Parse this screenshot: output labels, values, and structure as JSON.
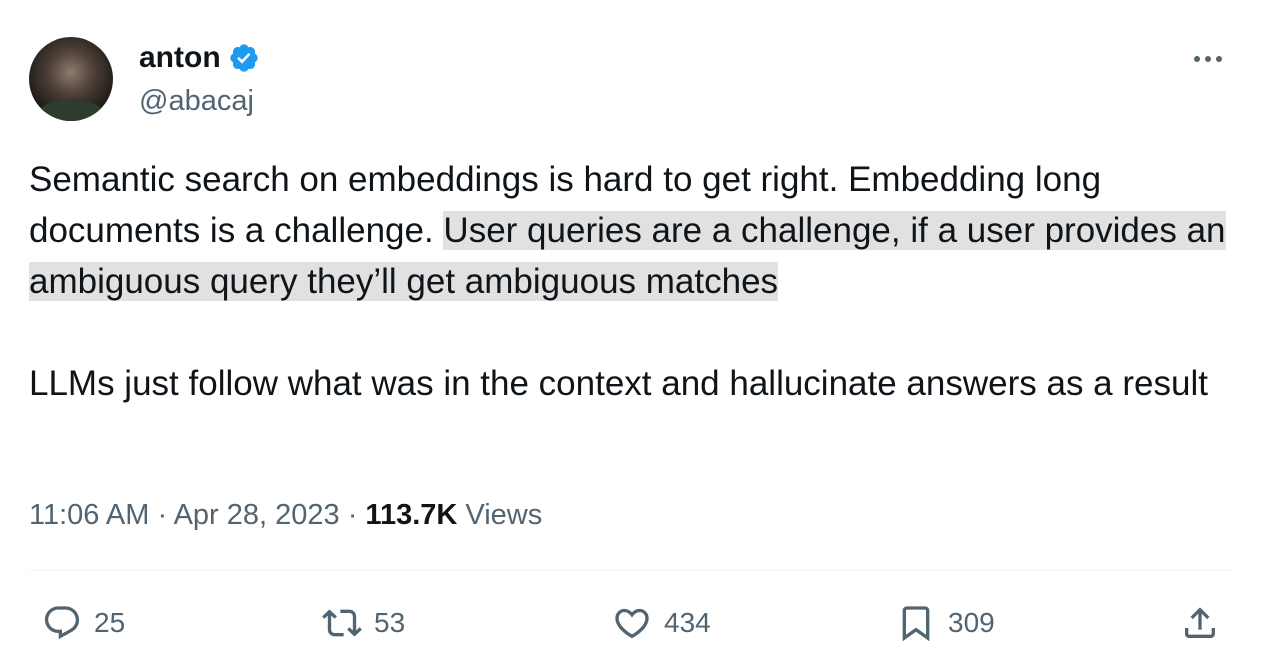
{
  "author": {
    "display_name": "anton",
    "handle": "@abacaj",
    "verified": true,
    "verified_color": "#1d9bf0"
  },
  "tweet": {
    "paragraph1_plain": "Semantic search on embeddings is hard to get right. Embedding long documents is a challenge. ",
    "paragraph1_highlighted": "User queries are a challenge, if a user provides an ambiguous query they’ll get ambiguous matches",
    "paragraph2": "LLMs just follow what was in the context and hallucinate answers as a result"
  },
  "meta": {
    "time": "11:06 AM",
    "separator": " · ",
    "date": "Apr 28, 2023",
    "views_count": "113.7K",
    "views_label": " Views"
  },
  "actions": {
    "replies": "25",
    "retweets": "53",
    "likes": "434",
    "bookmarks": "309"
  },
  "icons": {
    "more": "more-horizontal-icon",
    "reply": "reply-bubble-icon",
    "retweet": "retweet-icon",
    "like": "heart-icon",
    "bookmark": "bookmark-icon",
    "share": "share-icon"
  },
  "colors": {
    "text": "#0f1419",
    "secondary": "#536471",
    "highlight": "#e1e1e1",
    "divider": "#eff3f4"
  }
}
